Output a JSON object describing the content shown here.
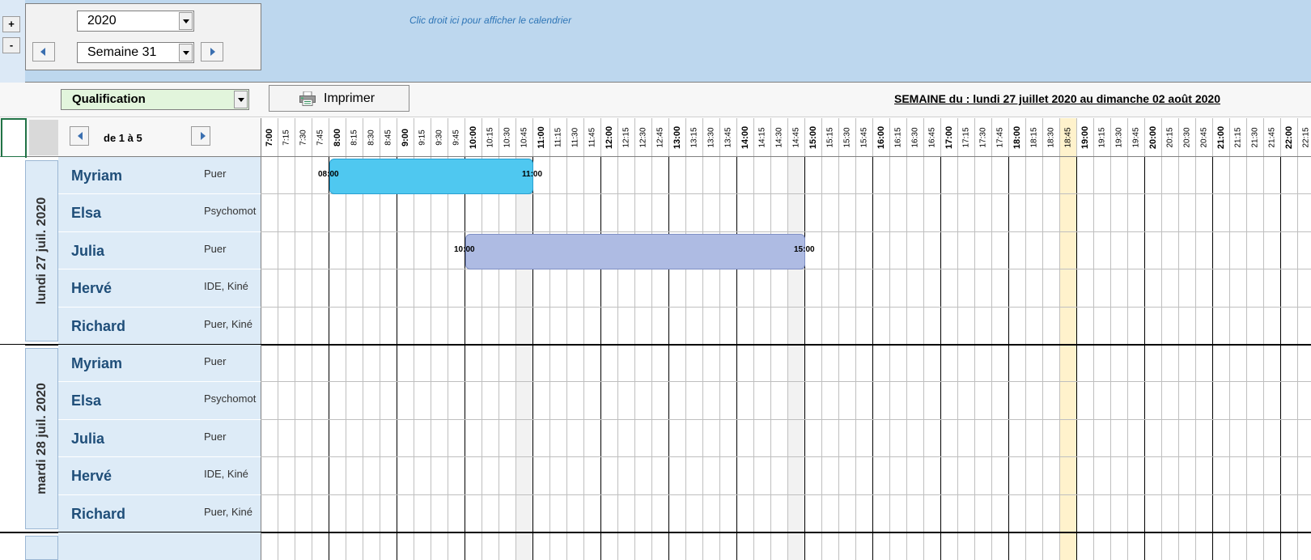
{
  "toolbar": {
    "plus_label": "+",
    "minus_label": "-",
    "year": "2020",
    "week": "Semaine 31",
    "hint": "Clic droit ici pour afficher le calendrier"
  },
  "filters": {
    "qualification": "Qualification",
    "print_label": "Imprimer",
    "week_title": "SEMAINE du  :  lundi 27 juillet 2020  au  dimanche 02 août 2020"
  },
  "header": {
    "range_label": "de 1 à 5",
    "times": [
      "7:00",
      "7:15",
      "7:30",
      "7:45",
      "8:00",
      "8:15",
      "8:30",
      "8:45",
      "9:00",
      "9:15",
      "9:30",
      "9:45",
      "10:00",
      "10:15",
      "10:30",
      "10:45",
      "11:00",
      "11:15",
      "11:30",
      "11:45",
      "12:00",
      "12:15",
      "12:30",
      "12:45",
      "13:00",
      "13:15",
      "13:30",
      "13:45",
      "14:00",
      "14:15",
      "14:30",
      "14:45",
      "15:00",
      "15:15",
      "15:30",
      "15:45",
      "16:00",
      "16:15",
      "16:30",
      "16:45",
      "17:00",
      "17:15",
      "17:30",
      "17:45",
      "18:00",
      "18:15",
      "18:30",
      "18:45",
      "19:00",
      "19:15",
      "19:30",
      "19:45",
      "20:00",
      "20:15",
      "20:30",
      "20:45",
      "21:00",
      "21:15",
      "21:30",
      "21:45",
      "22:00",
      "22:15"
    ],
    "highlight_time": "18:45"
  },
  "days": [
    {
      "label": "lundi 27 juil. 2020",
      "people": [
        {
          "name": "Myriam",
          "qual": "Puer"
        },
        {
          "name": "Elsa",
          "qual": "Psychomot"
        },
        {
          "name": "Julia",
          "qual": "Puer"
        },
        {
          "name": "Hervé",
          "qual": "IDE, Kiné"
        },
        {
          "name": "Richard",
          "qual": "Puer, Kiné"
        }
      ],
      "shifts": [
        {
          "row": 0,
          "start": "08:00",
          "end": "11:00",
          "color": "#4fc8f0",
          "border": "#2a9fd0"
        },
        {
          "row": 2,
          "start": "10:00",
          "end": "15:00",
          "color": "#aebbe3",
          "border": "#7f8fc4"
        }
      ]
    },
    {
      "label": "mardi 28 juil. 2020",
      "people": [
        {
          "name": "Myriam",
          "qual": "Puer"
        },
        {
          "name": "Elsa",
          "qual": "Psychomot"
        },
        {
          "name": "Julia",
          "qual": "Puer"
        },
        {
          "name": "Hervé",
          "qual": "IDE, Kiné"
        },
        {
          "name": "Richard",
          "qual": "Puer, Kiné"
        }
      ],
      "shifts": []
    }
  ],
  "colors": {
    "top_band": "#bdd7ee",
    "name_cell": "#ddebf7",
    "highlight_col": "#fff2cc",
    "weekend_col": "#f2f2f2"
  }
}
